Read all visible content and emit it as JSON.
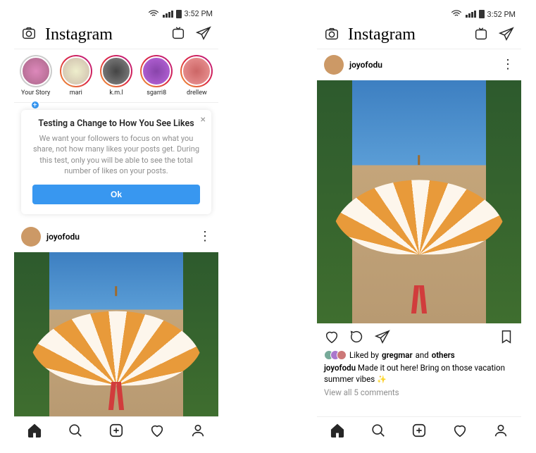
{
  "status": {
    "time": "3:52 PM"
  },
  "header": {
    "logo": "Instagram"
  },
  "stories": [
    {
      "label": "Your Story",
      "own": true
    },
    {
      "label": "mari"
    },
    {
      "label": "k.m.l"
    },
    {
      "label": "sgarri8"
    },
    {
      "label": "drellew"
    }
  ],
  "notice": {
    "title": "Testing a Change to How You See Likes",
    "body": "We want your followers to focus on what you share, not how many likes your posts get. During this test, only you will be able to see the total number of likes on your posts.",
    "ok": "Ok"
  },
  "post": {
    "username": "joyofodu",
    "liked_by_prefix": "Liked by ",
    "liked_by_user": "gregmar",
    "liked_by_and": " and ",
    "liked_by_others": "others",
    "caption": "Made it out here! Bring on those vacation summer vibes ",
    "emoji": "✨",
    "view_comments": "View all 5 comments"
  }
}
